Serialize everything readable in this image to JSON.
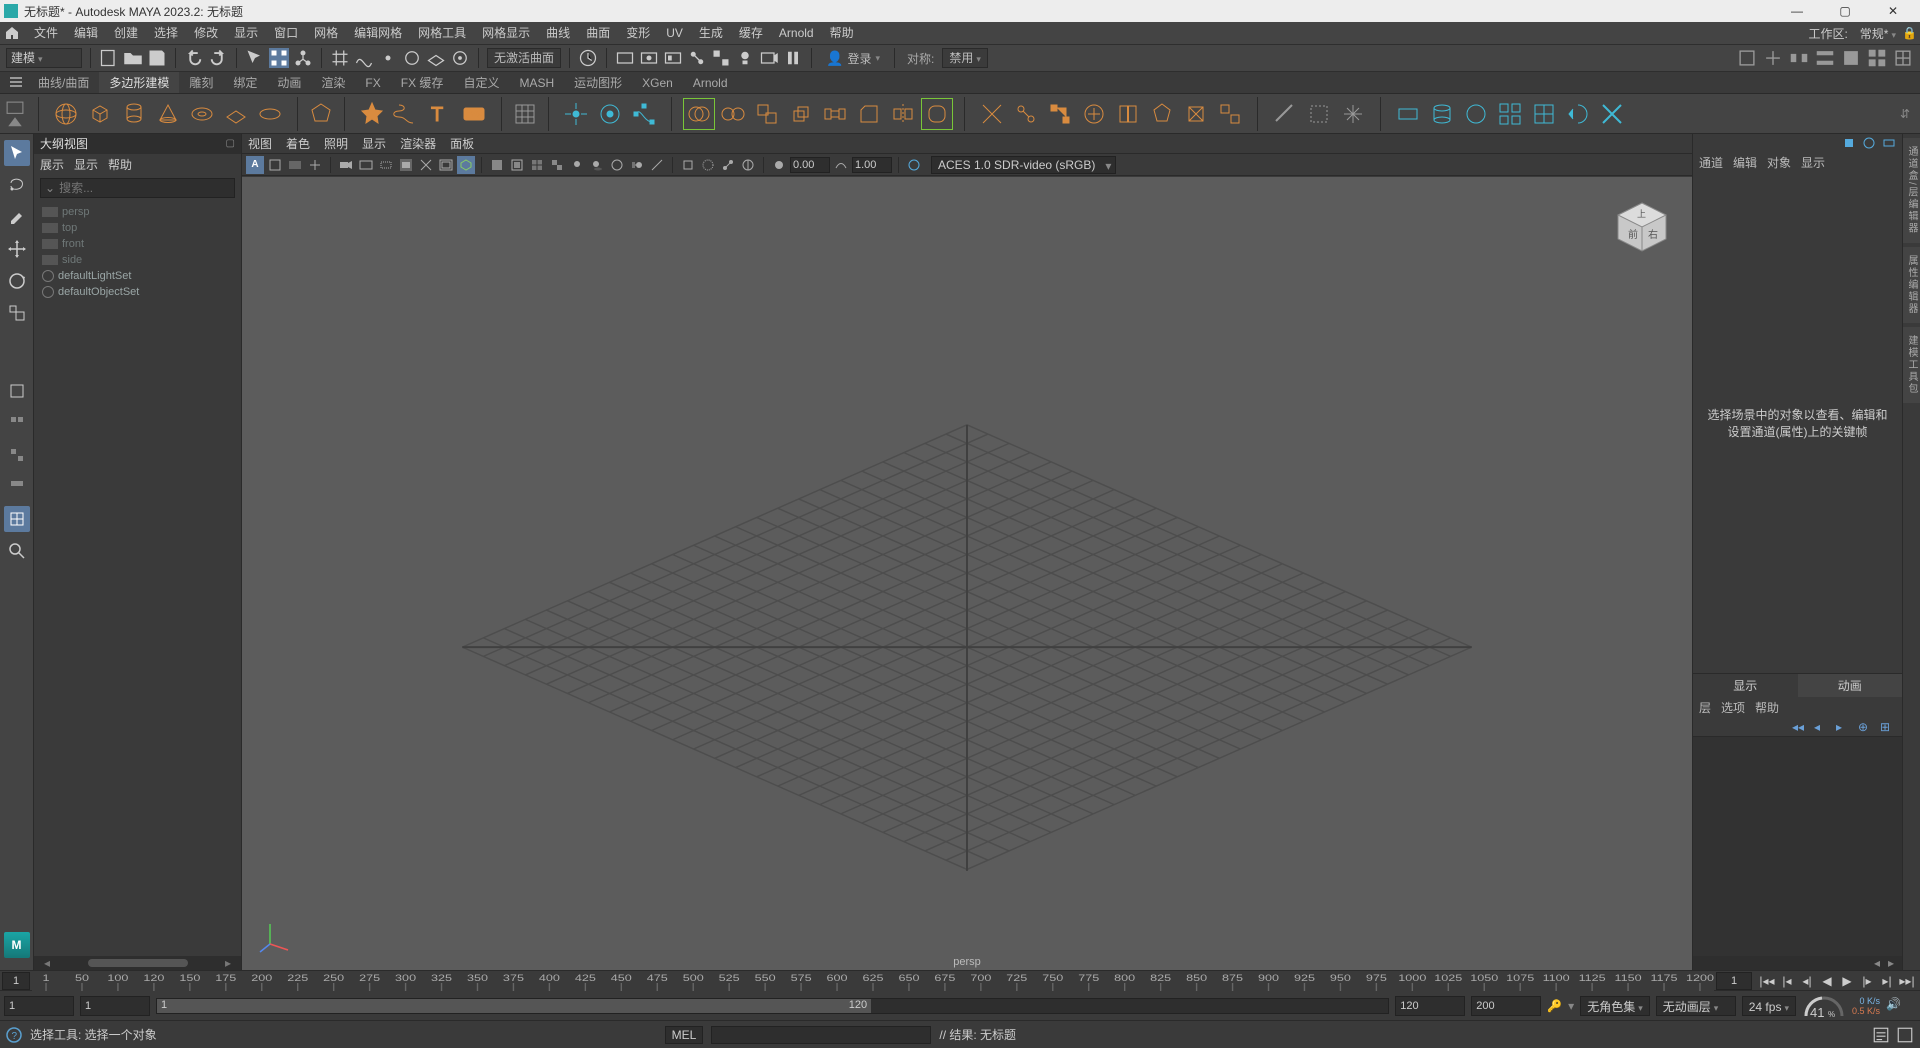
{
  "window": {
    "title": "无标题* - Autodesk MAYA 2023.2: 无标题",
    "minimize": "—",
    "maximize": "▢",
    "close": "✕"
  },
  "menubar": {
    "items": [
      "文件",
      "编辑",
      "创建",
      "选择",
      "修改",
      "显示",
      "窗口",
      "网格",
      "编辑网格",
      "网格工具",
      "网格显示",
      "曲线",
      "曲面",
      "变形",
      "UV",
      "生成",
      "缓存",
      "Arnold",
      "帮助"
    ],
    "workspace_label": "工作区:",
    "workspace_value": "常规*"
  },
  "statusline": {
    "mode": "建模",
    "no_active_surface": "无激活曲面",
    "sym_label": "对称:",
    "sym_value": "禁用",
    "login": "登录"
  },
  "shelftabs": [
    "曲线/曲面",
    "多边形建模",
    "雕刻",
    "绑定",
    "动画",
    "渲染",
    "FX",
    "FX 缓存",
    "自定义",
    "MASH",
    "运动图形",
    "XGen",
    "Arnold"
  ],
  "shelftabs_active_index": 1,
  "outliner": {
    "title": "大纲视图",
    "menus": [
      "展示",
      "显示",
      "帮助"
    ],
    "search_ph": "搜索...",
    "nodes": [
      {
        "type": "cam",
        "label": "persp",
        "dim": true
      },
      {
        "type": "cam",
        "label": "top",
        "dim": true
      },
      {
        "type": "cam",
        "label": "front",
        "dim": true
      },
      {
        "type": "cam",
        "label": "side",
        "dim": true
      },
      {
        "type": "set",
        "label": "defaultLightSet",
        "dim": false
      },
      {
        "type": "set",
        "label": "defaultObjectSet",
        "dim": false
      }
    ]
  },
  "viewpanel": {
    "menus": [
      "视图",
      "着色",
      "照明",
      "显示",
      "渲染器",
      "面板"
    ],
    "gate_a": "A",
    "near": "0.00",
    "far": "1.00",
    "colorspace": "ACES 1.0 SDR-video (sRGB)",
    "camlabel": "persp"
  },
  "channelbox": {
    "menus": [
      "通道",
      "编辑",
      "对象",
      "显示"
    ],
    "placeholder": "选择场景中的对象以查看、编辑和设置通道(属性)上的关键帧",
    "layer_tabs": [
      "显示",
      "动画"
    ],
    "layer_menus": [
      "层",
      "选项",
      "帮助"
    ]
  },
  "rightedge_tabs": [
    "通道盒/层编辑器",
    "属性编辑器",
    "建模工具包"
  ],
  "timeline": {
    "current": "1",
    "start": "1",
    "end": "120",
    "range_start": "1",
    "range_end": "120",
    "play_end_a": "120",
    "play_end_b": "200",
    "no_char_set": "无角色集",
    "no_anim_layer": "无动画层",
    "fps": "24 fps",
    "ticks": [
      1,
      50,
      100,
      120,
      150,
      175,
      200,
      225,
      250,
      275,
      300,
      325,
      350,
      375,
      400,
      425,
      450,
      475,
      500,
      525,
      550,
      575,
      600,
      625,
      650,
      675,
      700,
      725,
      750,
      775,
      800,
      825,
      850,
      875,
      900,
      925,
      950,
      975,
      1000,
      1025,
      1050,
      1075,
      1100,
      1125,
      1150,
      1175,
      1200
    ],
    "tick_labels": [
      "1",
      "50",
      "100",
      "120",
      "150",
      "175",
      "200",
      "225",
      "250",
      "275",
      "300",
      "325",
      "350",
      "375",
      "400",
      "425",
      "450",
      "475",
      "500",
      "525",
      "550",
      "575",
      "600",
      "625",
      "650",
      "675",
      "700",
      "725",
      "750",
      "775",
      "800",
      "825",
      "850",
      "875",
      "900",
      "925",
      "950",
      "975",
      "1000",
      "1025",
      "1050",
      "1075",
      "1100",
      "1125",
      "1150",
      "1175",
      "1200"
    ],
    "gauge": "41",
    "gauge_unit": "%",
    "rate1": "0 K/s",
    "rate2": "0.5 K/s"
  },
  "bottom": {
    "status": "选择工具: 选择一个对象",
    "mel": "MEL",
    "result": "// 结果: 无标题"
  },
  "viewcube": {
    "front": "前",
    "right": "右",
    "top": "上"
  }
}
